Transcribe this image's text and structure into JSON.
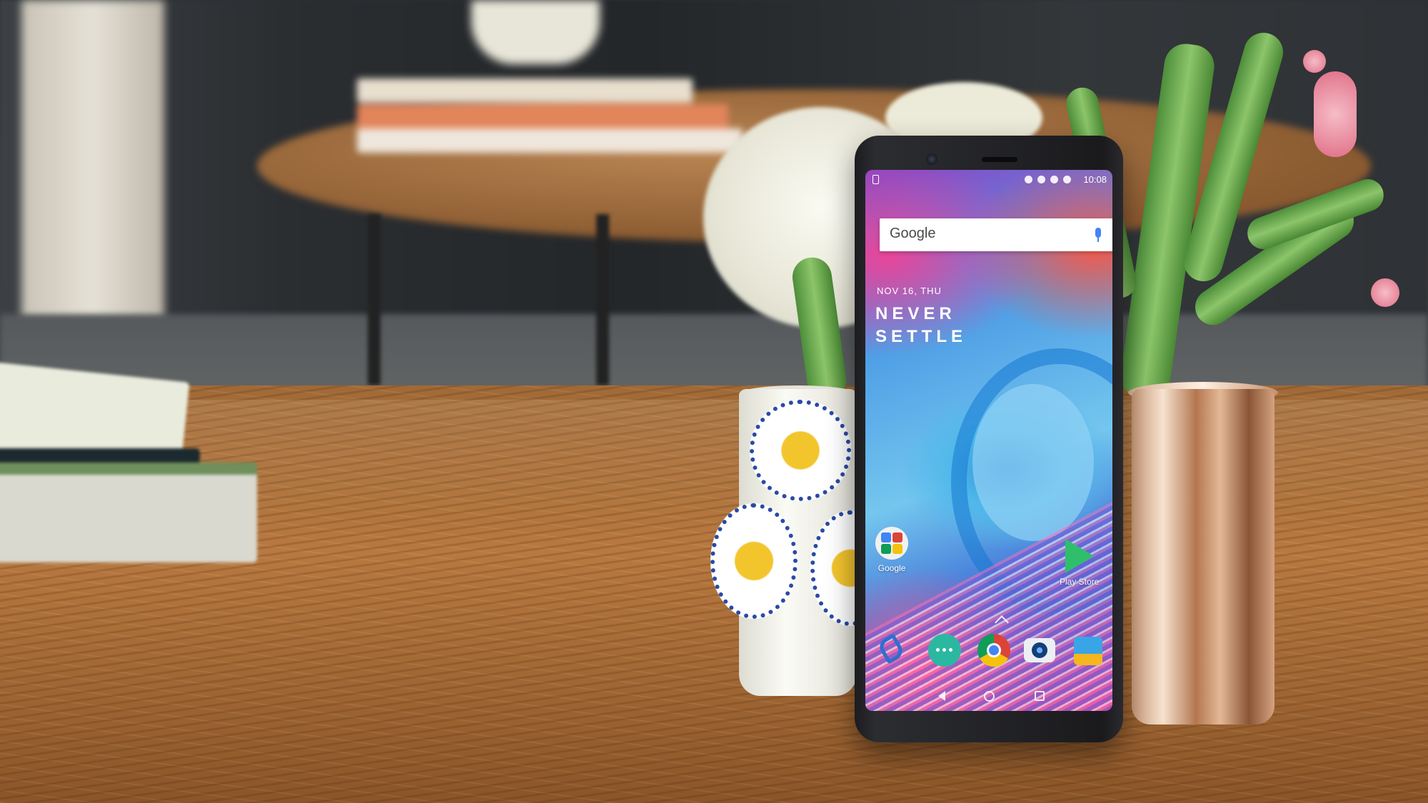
{
  "status_bar": {
    "time": "10:08"
  },
  "search_widget": {
    "logo_text": "Google"
  },
  "home": {
    "date": "NOV 16, THU",
    "slogan_line1": "NEVER",
    "slogan_line2": "SETTLE"
  },
  "apps": [
    {
      "label": "Google",
      "icon": "google-folder-icon"
    },
    {
      "label": "Play Store",
      "icon": "play-store-icon"
    }
  ],
  "dock": [
    {
      "icon": "phone-icon"
    },
    {
      "icon": "messages-icon"
    },
    {
      "icon": "chrome-icon"
    },
    {
      "icon": "camera-icon"
    },
    {
      "icon": "gallery-icon"
    }
  ],
  "colors": {
    "wood": "#b87940",
    "phone_body": "#1c1c1f",
    "play_green": "#2fbf6a",
    "google_blue": "#4285f4"
  }
}
